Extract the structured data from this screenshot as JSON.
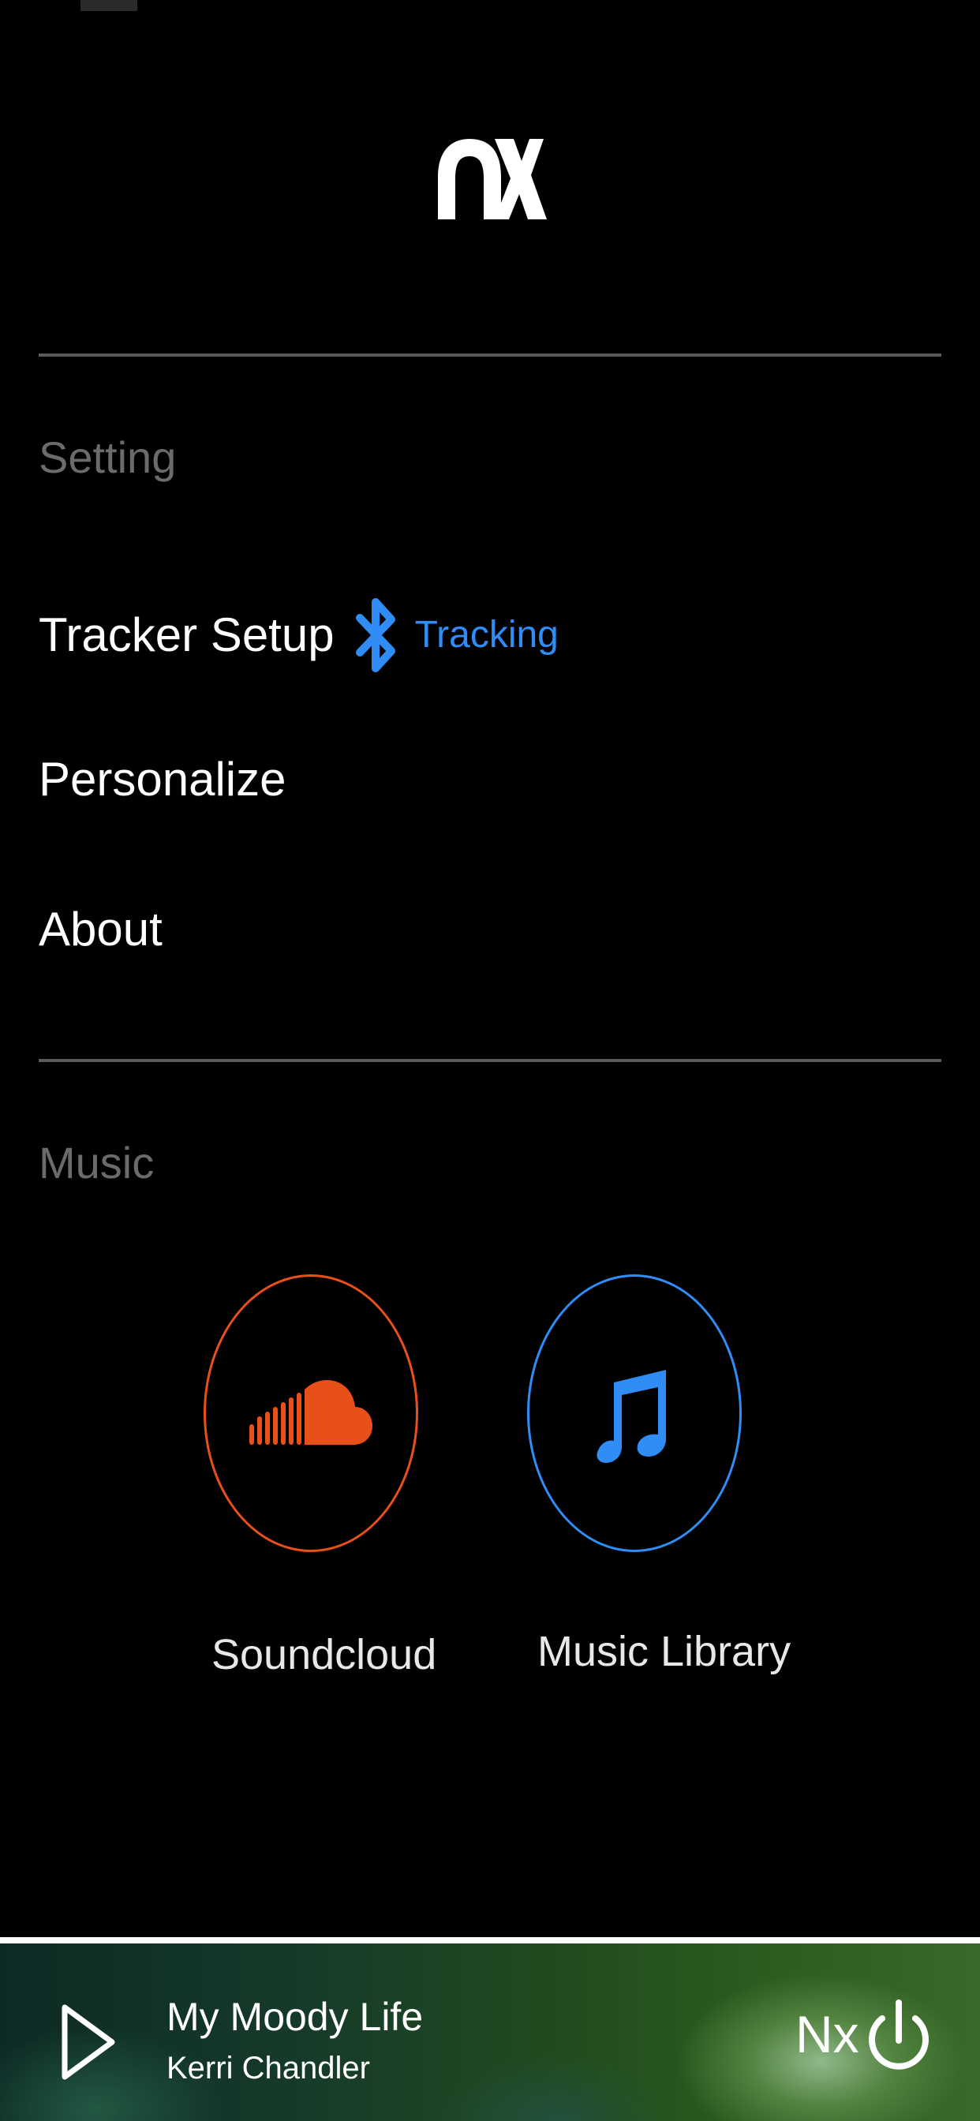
{
  "app": {
    "logo_icon": "nx-logo"
  },
  "settings": {
    "section_title": "Setting",
    "tracker_setup_label": "Tracker Setup",
    "tracker_icon": "bluetooth-icon",
    "tracking_status": "Tracking",
    "personalize_label": "Personalize",
    "about_label": "About"
  },
  "music": {
    "section_title": "Music",
    "sources": [
      {
        "label": "Soundcloud",
        "icon": "soundcloud-icon",
        "color": "#e8501a"
      },
      {
        "label": "Music Library",
        "icon": "music-note-icon",
        "color": "#2f8df5"
      }
    ]
  },
  "player": {
    "track_title": "My Moody Life",
    "track_artist": "Kerri Chandler",
    "play_icon": "play-icon",
    "device_label": "Nx",
    "power_icon": "power-icon"
  },
  "colors": {
    "background": "#000000",
    "section_title": "#6b6b6b",
    "accent_blue": "#2f8df5",
    "soundcloud_orange": "#e8501a",
    "divider": "#5a5a5a"
  }
}
